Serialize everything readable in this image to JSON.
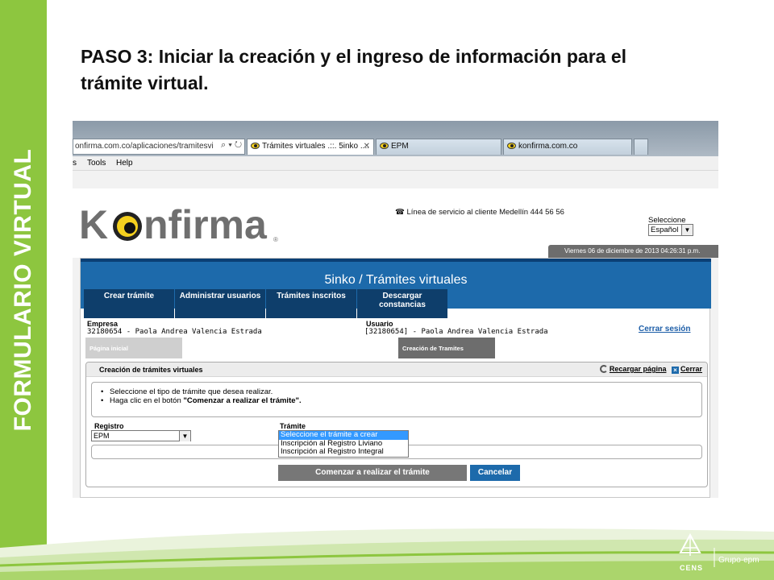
{
  "sidebar": {
    "vertical_title": "FORMULARIO VIRTUAL"
  },
  "slide": {
    "title": "PASO 3: Iniciar la creación y el ingreso de información para el trámite virtual."
  },
  "browser": {
    "address": "onfirma.com.co/aplicaciones/tramitesvi",
    "address_controls": "⌕ ▾ ↻",
    "tabs": [
      {
        "label": "Trámites virtuales .::. 5inko ....",
        "active": true
      },
      {
        "label": "EPM",
        "active": false
      },
      {
        "label": "konfirma.com.co",
        "active": false
      }
    ],
    "menu": [
      "s",
      "Tools",
      "Help"
    ]
  },
  "site": {
    "logo_text": "Konfirma",
    "service_line": "Línea de servicio al cliente Medellín 444 56 56",
    "language_label": "Seleccione",
    "language_value": "Español",
    "date_text": "Viernes 06 de diciembre de 2013 04:26:31 p.m.",
    "banner_title": "5inko / Trámites virtuales",
    "nav_tabs": [
      "Crear trámite",
      "Administrar usuarios",
      "Trámites inscritos",
      "Descargar\nconstancias"
    ],
    "empresa_label": "Empresa",
    "empresa_value": "32180654 - Paola Andrea Valencia Estrada",
    "usuario_label": "Usuario",
    "usuario_value": "[32180654] - Paola Andrea Valencia Estrada",
    "logout": "Cerrar sesión",
    "crumb_home": "Página inicial",
    "crumb_current": "Creación de Tramites"
  },
  "panel": {
    "title": "Creación de trámites virtuales",
    "reload": "Recargar página",
    "close": "Cerrar",
    "instructions": [
      "Seleccione el tipo de trámite que desea realizar.",
      "Haga clic en el botón"
    ],
    "instruction_bold": "\"Comenzar a realizar el trámite\".",
    "registro_label": "Registro",
    "registro_value": "EPM",
    "tramite_label": "Trámite",
    "tramite_options": [
      "Seleccione el trámite a crear",
      "Inscripción al Registro Liviano",
      "Inscripción al Registro Integral"
    ],
    "start_button": "Comenzar a realizar el trámite",
    "cancel_button": "Cancelar"
  },
  "footer": {
    "logo_text": "CENS",
    "brand_text": "Grupo·epm"
  },
  "colors": {
    "sidebar_green": "#8dc63f",
    "banner_blue": "#1d6aab",
    "nav_navy": "#0e3e6b"
  }
}
